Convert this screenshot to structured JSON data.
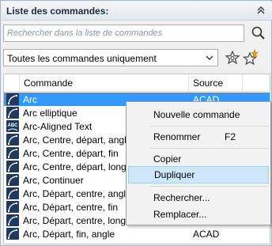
{
  "panel": {
    "title": "Liste des commandes:",
    "collapse_icon": "double-chevron-up-icon"
  },
  "search": {
    "placeholder": "Rechercher dans la liste de commandes",
    "button_icon": "search-icon"
  },
  "filter": {
    "selected": "Toutes les commandes uniquement",
    "arrow_icon": "chevron-down-icon",
    "buttons": [
      "star-filter-icon",
      "new-star-icon"
    ]
  },
  "list": {
    "columns": [
      "Commande",
      "Source"
    ],
    "rows": [
      {
        "name": "Arc",
        "source": "ACAD",
        "selected": true
      },
      {
        "name": "Arc elliptique",
        "source": "",
        "selected": false
      },
      {
        "name": "Arc-Aligned Text",
        "source": "",
        "selected": false
      },
      {
        "name": "Arc, Centre, départ, angle",
        "source": "",
        "selected": false
      },
      {
        "name": "Arc, Centre, départ, fin",
        "source": "",
        "selected": false
      },
      {
        "name": "Arc, Centre, départ, longueur",
        "source": "",
        "selected": false
      },
      {
        "name": "Arc, Continuer",
        "source": "",
        "selected": false
      },
      {
        "name": "Arc, Départ, centre, angle",
        "source": "",
        "selected": false
      },
      {
        "name": "Arc, Départ, centre, fin",
        "source": "",
        "selected": false
      },
      {
        "name": "Arc, Départ, centre, longueur",
        "source": "",
        "selected": false
      },
      {
        "name": "Arc, Départ, fin, angle",
        "source": "ACAD",
        "selected": false
      }
    ]
  },
  "context_menu": {
    "items": [
      {
        "label": "Nouvelle commande",
        "shortcut": ""
      },
      {
        "label": "Renommer",
        "shortcut": "F2"
      },
      {
        "label": "Copier",
        "shortcut": ""
      },
      {
        "label": "Dupliquer",
        "shortcut": "",
        "highlighted": true
      },
      {
        "label": "Rechercher...",
        "shortcut": ""
      },
      {
        "label": "Remplacer...",
        "shortcut": ""
      }
    ]
  },
  "colors": {
    "selection": "#3399ff",
    "menu_highlight": "#cce8ff",
    "icon_bg": "#1f3a5e"
  }
}
